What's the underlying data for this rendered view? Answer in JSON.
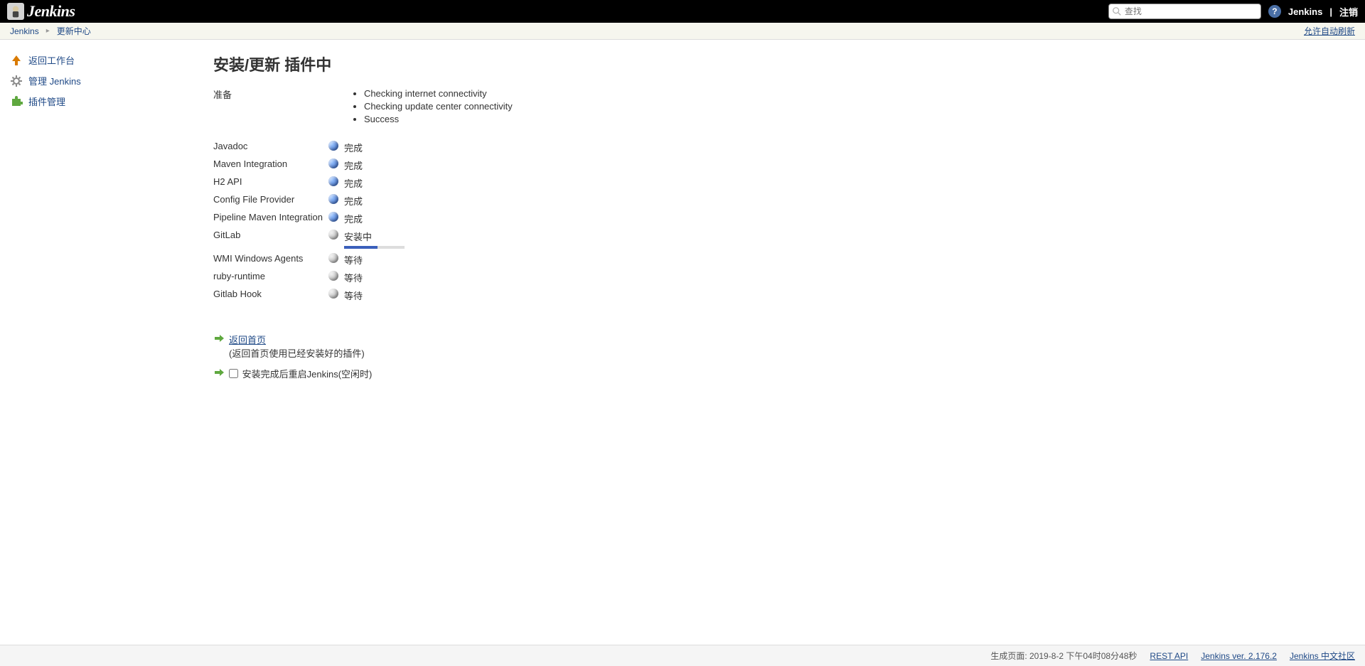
{
  "header": {
    "logo_text": "Jenkins",
    "search_placeholder": "查找",
    "user_link": "Jenkins",
    "logout": "注销"
  },
  "breadcrumbs": {
    "items": [
      "Jenkins",
      "更新中心"
    ],
    "auto_refresh": "允许自动刷新"
  },
  "sidebar": {
    "items": [
      {
        "label": "返回工作台",
        "icon": "up-arrow"
      },
      {
        "label": "管理 Jenkins",
        "icon": "gear"
      },
      {
        "label": "插件管理",
        "icon": "puzzle"
      }
    ]
  },
  "main": {
    "title": "安装/更新 插件中",
    "prepare_label": "准备",
    "prepare_steps": [
      "Checking internet connectivity",
      "Checking update center connectivity",
      "Success"
    ],
    "plugins": [
      {
        "name": "Javadoc",
        "status": "完成",
        "state": "done"
      },
      {
        "name": "Maven Integration",
        "status": "完成",
        "state": "done"
      },
      {
        "name": "H2 API",
        "status": "完成",
        "state": "done"
      },
      {
        "name": "Config File Provider",
        "status": "完成",
        "state": "done"
      },
      {
        "name": "Pipeline Maven Integration",
        "status": "完成",
        "state": "done"
      },
      {
        "name": "GitLab",
        "status": "安装中",
        "state": "installing",
        "progress": 55
      },
      {
        "name": "WMI Windows Agents",
        "status": "等待",
        "state": "pending"
      },
      {
        "name": "ruby-runtime",
        "status": "等待",
        "state": "pending"
      },
      {
        "name": "Gitlab Hook",
        "status": "等待",
        "state": "pending"
      }
    ],
    "return_link": "返回首页",
    "return_note": "(返回首页使用已经安装好的插件)",
    "restart_label": "安装完成后重启Jenkins(空闲时)"
  },
  "footer": {
    "generated": "生成页面: 2019-8-2 下午04时08分48秒",
    "rest_api": "REST API",
    "version": "Jenkins ver. 2.176.2",
    "community": "Jenkins 中文社区"
  }
}
